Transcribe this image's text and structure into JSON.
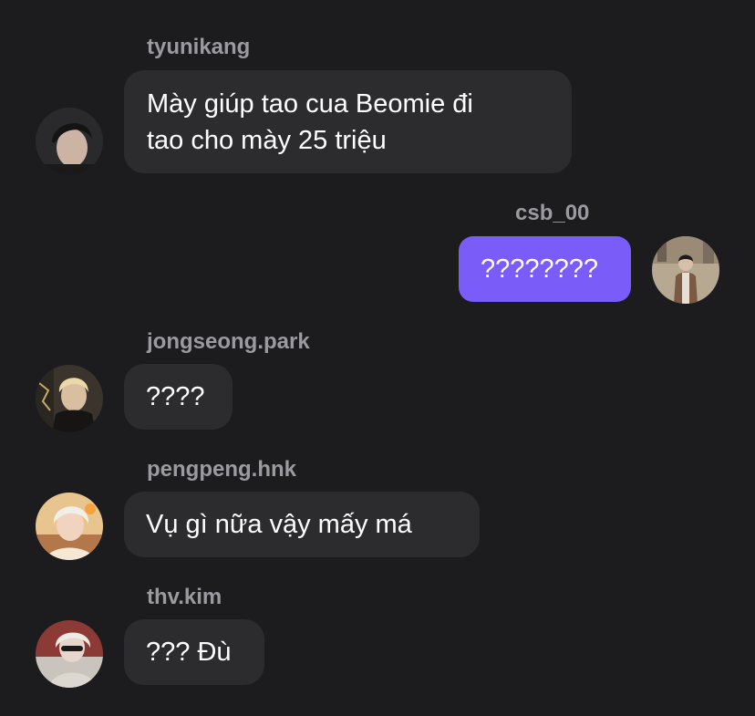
{
  "messages": [
    {
      "sender": "tyunikang",
      "text_lines": [
        "Mày giúp tao cua Beomie đi",
        "tao cho mày 25 triệu"
      ],
      "outgoing": false,
      "avatar_icon": "user-avatar-photo"
    },
    {
      "sender": "csb_00",
      "text_lines": [
        "????????"
      ],
      "outgoing": true,
      "avatar_icon": "user-avatar-photo"
    },
    {
      "sender": "jongseong.park",
      "text_lines": [
        "????"
      ],
      "outgoing": false,
      "avatar_icon": "user-avatar-photo"
    },
    {
      "sender": "pengpeng.hnk",
      "text_lines": [
        "Vụ gì nữa vậy mấy má"
      ],
      "outgoing": false,
      "avatar_icon": "user-avatar-photo"
    },
    {
      "sender": "thv.kim",
      "text_lines": [
        "??? Đù"
      ],
      "outgoing": false,
      "avatar_icon": "user-avatar-photo"
    }
  ],
  "colors": {
    "background": "#1c1c1e",
    "incoming_bubble": "#2c2c2e",
    "outgoing_bubble": "#7a5cf8",
    "sender_name": "#9a9aa0",
    "text": "#ffffff"
  }
}
